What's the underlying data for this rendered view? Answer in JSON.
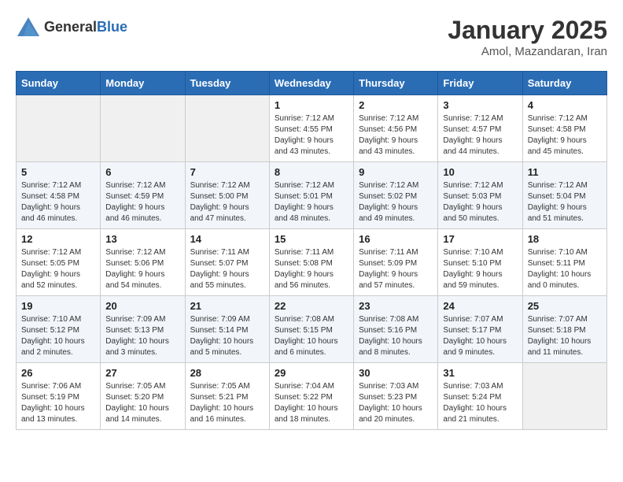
{
  "header": {
    "logo_general": "General",
    "logo_blue": "Blue",
    "month": "January 2025",
    "location": "Amol, Mazandaran, Iran"
  },
  "weekdays": [
    "Sunday",
    "Monday",
    "Tuesday",
    "Wednesday",
    "Thursday",
    "Friday",
    "Saturday"
  ],
  "weeks": [
    [
      {
        "day": "",
        "info": ""
      },
      {
        "day": "",
        "info": ""
      },
      {
        "day": "",
        "info": ""
      },
      {
        "day": "1",
        "info": "Sunrise: 7:12 AM\nSunset: 4:55 PM\nDaylight: 9 hours and 43 minutes."
      },
      {
        "day": "2",
        "info": "Sunrise: 7:12 AM\nSunset: 4:56 PM\nDaylight: 9 hours and 43 minutes."
      },
      {
        "day": "3",
        "info": "Sunrise: 7:12 AM\nSunset: 4:57 PM\nDaylight: 9 hours and 44 minutes."
      },
      {
        "day": "4",
        "info": "Sunrise: 7:12 AM\nSunset: 4:58 PM\nDaylight: 9 hours and 45 minutes."
      }
    ],
    [
      {
        "day": "5",
        "info": "Sunrise: 7:12 AM\nSunset: 4:58 PM\nDaylight: 9 hours and 46 minutes."
      },
      {
        "day": "6",
        "info": "Sunrise: 7:12 AM\nSunset: 4:59 PM\nDaylight: 9 hours and 46 minutes."
      },
      {
        "day": "7",
        "info": "Sunrise: 7:12 AM\nSunset: 5:00 PM\nDaylight: 9 hours and 47 minutes."
      },
      {
        "day": "8",
        "info": "Sunrise: 7:12 AM\nSunset: 5:01 PM\nDaylight: 9 hours and 48 minutes."
      },
      {
        "day": "9",
        "info": "Sunrise: 7:12 AM\nSunset: 5:02 PM\nDaylight: 9 hours and 49 minutes."
      },
      {
        "day": "10",
        "info": "Sunrise: 7:12 AM\nSunset: 5:03 PM\nDaylight: 9 hours and 50 minutes."
      },
      {
        "day": "11",
        "info": "Sunrise: 7:12 AM\nSunset: 5:04 PM\nDaylight: 9 hours and 51 minutes."
      }
    ],
    [
      {
        "day": "12",
        "info": "Sunrise: 7:12 AM\nSunset: 5:05 PM\nDaylight: 9 hours and 52 minutes."
      },
      {
        "day": "13",
        "info": "Sunrise: 7:12 AM\nSunset: 5:06 PM\nDaylight: 9 hours and 54 minutes."
      },
      {
        "day": "14",
        "info": "Sunrise: 7:11 AM\nSunset: 5:07 PM\nDaylight: 9 hours and 55 minutes."
      },
      {
        "day": "15",
        "info": "Sunrise: 7:11 AM\nSunset: 5:08 PM\nDaylight: 9 hours and 56 minutes."
      },
      {
        "day": "16",
        "info": "Sunrise: 7:11 AM\nSunset: 5:09 PM\nDaylight: 9 hours and 57 minutes."
      },
      {
        "day": "17",
        "info": "Sunrise: 7:10 AM\nSunset: 5:10 PM\nDaylight: 9 hours and 59 minutes."
      },
      {
        "day": "18",
        "info": "Sunrise: 7:10 AM\nSunset: 5:11 PM\nDaylight: 10 hours and 0 minutes."
      }
    ],
    [
      {
        "day": "19",
        "info": "Sunrise: 7:10 AM\nSunset: 5:12 PM\nDaylight: 10 hours and 2 minutes."
      },
      {
        "day": "20",
        "info": "Sunrise: 7:09 AM\nSunset: 5:13 PM\nDaylight: 10 hours and 3 minutes."
      },
      {
        "day": "21",
        "info": "Sunrise: 7:09 AM\nSunset: 5:14 PM\nDaylight: 10 hours and 5 minutes."
      },
      {
        "day": "22",
        "info": "Sunrise: 7:08 AM\nSunset: 5:15 PM\nDaylight: 10 hours and 6 minutes."
      },
      {
        "day": "23",
        "info": "Sunrise: 7:08 AM\nSunset: 5:16 PM\nDaylight: 10 hours and 8 minutes."
      },
      {
        "day": "24",
        "info": "Sunrise: 7:07 AM\nSunset: 5:17 PM\nDaylight: 10 hours and 9 minutes."
      },
      {
        "day": "25",
        "info": "Sunrise: 7:07 AM\nSunset: 5:18 PM\nDaylight: 10 hours and 11 minutes."
      }
    ],
    [
      {
        "day": "26",
        "info": "Sunrise: 7:06 AM\nSunset: 5:19 PM\nDaylight: 10 hours and 13 minutes."
      },
      {
        "day": "27",
        "info": "Sunrise: 7:05 AM\nSunset: 5:20 PM\nDaylight: 10 hours and 14 minutes."
      },
      {
        "day": "28",
        "info": "Sunrise: 7:05 AM\nSunset: 5:21 PM\nDaylight: 10 hours and 16 minutes."
      },
      {
        "day": "29",
        "info": "Sunrise: 7:04 AM\nSunset: 5:22 PM\nDaylight: 10 hours and 18 minutes."
      },
      {
        "day": "30",
        "info": "Sunrise: 7:03 AM\nSunset: 5:23 PM\nDaylight: 10 hours and 20 minutes."
      },
      {
        "day": "31",
        "info": "Sunrise: 7:03 AM\nSunset: 5:24 PM\nDaylight: 10 hours and 21 minutes."
      },
      {
        "day": "",
        "info": ""
      }
    ]
  ]
}
